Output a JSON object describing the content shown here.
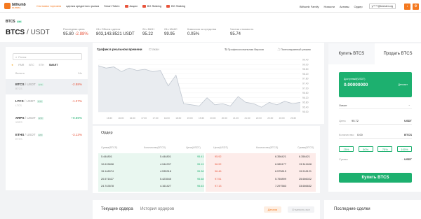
{
  "nav": {
    "logo_line1": "bithumb",
    "logo_line2": "GLOBAL",
    "items": [
      {
        "label": "Спотовая торговля",
        "active": true
      },
      {
        "label": "сделка кредитного рынка",
        "active": false
      },
      {
        "label": "Smart Token",
        "active": false
      },
      {
        "label": "Акции",
        "active": false,
        "tag": true
      },
      {
        "label": "BG Staking",
        "active": false,
        "tag": true
      },
      {
        "label": "BG Staking",
        "active": false,
        "tag": true
      }
    ],
    "right_items": [
      "Bithumb Family",
      "Новости",
      "Активы",
      "Ордер"
    ],
    "user": "y*****@beester.org"
  },
  "market": {
    "pair_small": "BTCS",
    "etf_badge": "ETF",
    "base": "BTCS",
    "quote": "/ USDT",
    "stats": [
      {
        "label": "Последняя цена",
        "value": "95.80",
        "extra": "-2.88%"
      },
      {
        "label": "24ч Объем сделок",
        "value": "803,143.8521 USDT"
      },
      {
        "label": "24ч МИН",
        "value": "95.22"
      },
      {
        "label": "24ч МАКС",
        "value": "99.95"
      },
      {
        "label": "Комиссия за средства",
        "value": "0.05%"
      },
      {
        "label": "Чистая стоимость",
        "value": "95.74"
      }
    ]
  },
  "left": {
    "search_placeholder": "Поиск",
    "tabs": [
      "★",
      "PAIR",
      "BTC",
      "ETH",
      "SMART"
    ],
    "col_left": "Валюта",
    "col_right": "24ч",
    "coins": [
      {
        "name": "BTCS",
        "quote": "/ USDT",
        "sub": "BTCS",
        "change": "-2.88%",
        "dir": "down",
        "active": true
      },
      {
        "name": "LTCS",
        "quote": "/ USDT",
        "sub": "LTCS",
        "change": "-1.27%",
        "dir": "down",
        "active": false
      },
      {
        "name": "XRPS",
        "quote": "/ USDT",
        "sub": "XRPS",
        "change": "+0.56%",
        "dir": "up",
        "active": false
      },
      {
        "name": "ETHS",
        "quote": "/ USDT",
        "sub": "ETHS",
        "change": "-3.13%",
        "dir": "down",
        "active": false
      }
    ]
  },
  "chart": {
    "tab_active": "График в реальном времени",
    "tab_other": "Стакан",
    "tool1": "Профессиональная Версия",
    "tool2": "Полноэкранный режим"
  },
  "chart_data": {
    "type": "area",
    "x": [
      "15:30",
      "16:00",
      "16:30",
      "17:00",
      "17:30",
      "18:00",
      "18:30",
      "19:00",
      "19:30",
      "20:00",
      "20:30",
      "21:00",
      "21:30",
      "22:00",
      "22:30",
      "23:00",
      "23:30"
    ],
    "values": [
      98.9,
      98.7,
      98.8,
      98.4,
      98.7,
      98.5,
      98.6,
      98.4,
      98.5,
      97.2,
      98.1,
      95.7,
      95.6,
      95.5,
      96.2,
      95.6,
      95.7,
      95.5,
      96.3,
      95.8,
      95.7,
      95.4,
      95.8,
      95.6,
      95.9,
      95.7,
      95.8
    ],
    "y_ticks": [
      "99.40",
      "99.00",
      "98.60",
      "98.20",
      "97.80",
      "97.40",
      "97.00",
      "96.60",
      "96.20",
      "95.80",
      "95.40",
      "95.00"
    ],
    "ylim": [
      95.0,
      99.6
    ],
    "line_color": "#bfc6cf",
    "fill_color": "#e9ecf0"
  },
  "orderbook": {
    "title": "Ордер",
    "headers": [
      "Сумма(BTCS)",
      "Количество(BTCS)",
      "Цена(USDT)",
      "Цена(USDT)",
      "Количество(BTCS)",
      "Сумма(BTCS)"
    ],
    "rows": [
      {
        "bid_sum": "5.444801",
        "bid_qty": "5.444801",
        "bid_price": "95.41",
        "ask_price": "95.92",
        "ask_qty": "6.356421",
        "ask_sum": "6.356421"
      },
      {
        "bid_sum": "10.615898",
        "bid_qty": "4.944297",
        "bid_price": "95.19",
        "ask_price": "96.92",
        "ask_qty": "6.985177",
        "ask_sum": "13.341608"
      },
      {
        "bid_sum": "15.148074",
        "bid_qty": "4.535318",
        "bid_price": "95.38",
        "ask_price": "96.46",
        "ask_qty": "6.575815",
        "ask_sum": "19.918121"
      },
      {
        "bid_sum": "20.571627",
        "bid_qty": "5.423545",
        "bid_price": "95.68",
        "ask_price": "97.51",
        "ask_qty": "5.750899",
        "ask_sum": "25.666022"
      },
      {
        "bid_sum": "24.743578",
        "bid_qty": "4.161427",
        "bid_price": "95.63",
        "ask_price": "97.13",
        "ask_qty": "7.297583",
        "ask_sum": "33.666632"
      }
    ]
  },
  "trade": {
    "tab_buy": "Купить BTCS",
    "tab_sell": "Продать BTCS",
    "balance_label": "Доступный(USDT)",
    "balance_value": "0.00000000",
    "deposit": "Депозит",
    "order_type": "Лимит",
    "price_label": "Цена",
    "price_value": "95.72",
    "price_unit": "USDT",
    "qty_label": "Количество",
    "qty_value": "0.00",
    "qty_unit": "BTCS",
    "percents": [
      "25%",
      "50%",
      "75%",
      "100%"
    ],
    "total_label": "Сумма",
    "total_value": "--",
    "total_unit": "USDT",
    "buy_button": "Купить BTCS"
  },
  "bottom": {
    "tab1": "Текущие ордера",
    "tab2": "История ордеров",
    "btn_details": "Детали",
    "btn_cancel_all": "Отменить все",
    "trades_title": "Последние сделки"
  }
}
